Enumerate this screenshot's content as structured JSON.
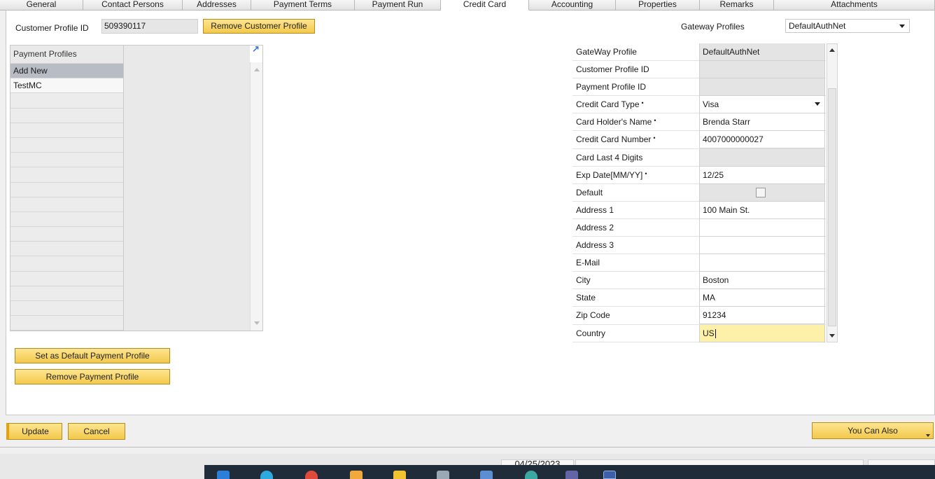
{
  "tabs": [
    {
      "label": "General",
      "width": 119
    },
    {
      "label": "Contact Persons",
      "width": 142
    },
    {
      "label": "Addresses",
      "width": 98
    },
    {
      "label": "Payment Terms",
      "width": 148
    },
    {
      "label": "Payment Run",
      "width": 123
    },
    {
      "label": "Credit Card",
      "width": 126,
      "active": true
    },
    {
      "label": "Accounting",
      "width": 124
    },
    {
      "label": "Properties",
      "width": 120
    },
    {
      "label": "Remarks",
      "width": 106
    },
    {
      "label": "Attachments",
      "width": 230
    }
  ],
  "customer_profile": {
    "label": "Customer Profile ID",
    "value": "509390117",
    "remove_button": "Remove Customer Profile"
  },
  "gateway": {
    "label": "Gateway Profiles",
    "selected": "DefaultAuthNet"
  },
  "payment_profiles": {
    "header": "Payment Profiles",
    "items": [
      "Add New",
      "TestMC"
    ],
    "set_default_button": "Set as Default Payment Profile",
    "remove_button": "Remove Payment Profile"
  },
  "form": {
    "rows": [
      {
        "label": "GateWay Profile",
        "value": "DefaultAuthNet",
        "type": "ro"
      },
      {
        "label": "Customer Profile ID",
        "value": "",
        "type": "ro"
      },
      {
        "label": "Payment Profile ID",
        "value": "",
        "type": "ro"
      },
      {
        "label": "Credit Card Type",
        "value": "Visa",
        "type": "select",
        "required": true
      },
      {
        "label": "Card Holder's Name",
        "value": "Brenda Starr",
        "type": "text",
        "required": true
      },
      {
        "label": "Credit Card Number",
        "value": "4007000000027",
        "type": "text",
        "required": true
      },
      {
        "label": "Card Last 4 Digits",
        "value": "",
        "type": "ro"
      },
      {
        "label": "Exp Date[MM/YY]",
        "value": "12/25",
        "type": "text",
        "required": true
      },
      {
        "label": "Default",
        "value": "",
        "type": "checkbox"
      },
      {
        "label": "Address 1",
        "value": "100 Main St.",
        "type": "text"
      },
      {
        "label": "Address 2",
        "value": "",
        "type": "text"
      },
      {
        "label": "Address 3",
        "value": "",
        "type": "text"
      },
      {
        "label": "E-Mail",
        "value": "",
        "type": "text"
      },
      {
        "label": "City",
        "value": "Boston",
        "type": "text"
      },
      {
        "label": "State",
        "value": "MA",
        "type": "text"
      },
      {
        "label": "Zip Code",
        "value": "91234",
        "type": "text"
      },
      {
        "label": "Country",
        "value": "US",
        "type": "active"
      }
    ],
    "required_mark": "•"
  },
  "footer": {
    "update_button": "Update",
    "cancel_button": "Cancel",
    "you_can_also_button": "You Can Also"
  },
  "status_bar": {
    "date": "04/25/2023"
  },
  "colors": {
    "button_yellow": "#f3c94c",
    "active_field": "#fdf0a8",
    "taskbar": "#202c3a"
  }
}
